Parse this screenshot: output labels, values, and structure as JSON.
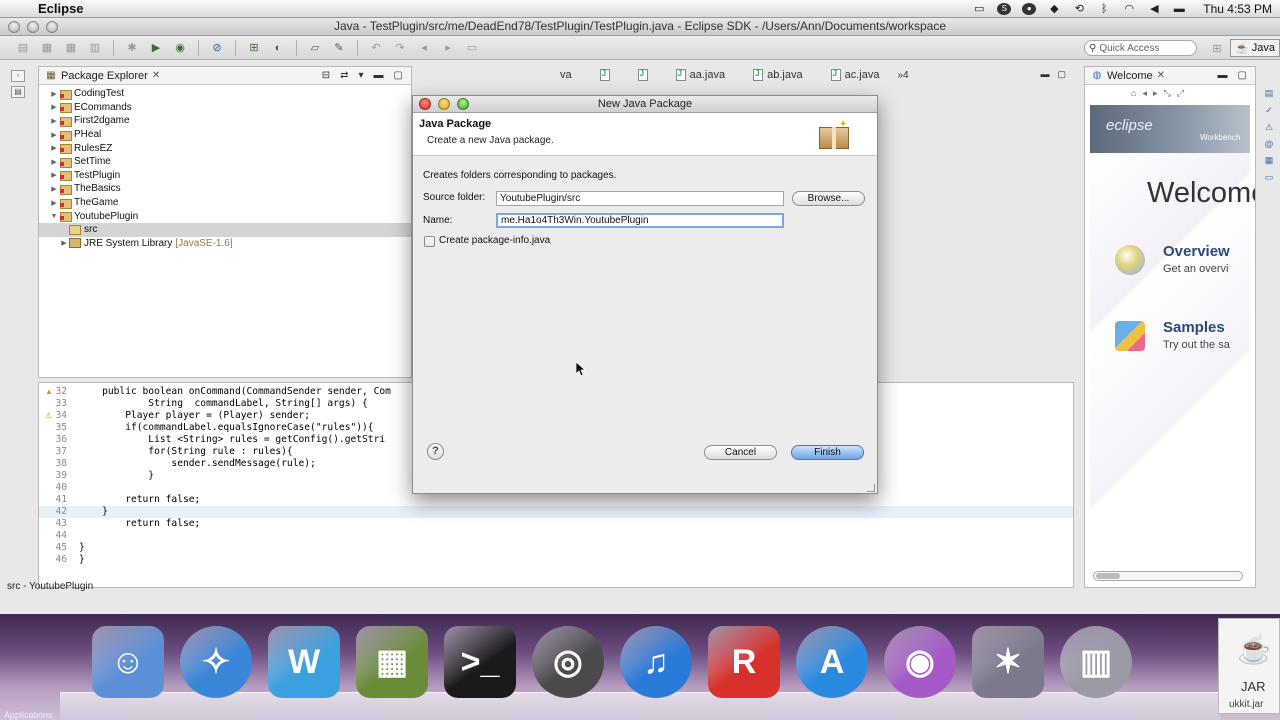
{
  "menubar": {
    "app_name": "Eclipse",
    "time": "Thu 4:53 PM"
  },
  "window": {
    "title": "Java - TestPlugin/src/me/DeadEnd78/TestPlugin/TestPlugin.java - Eclipse SDK - /Users/Ann/Documents/workspace"
  },
  "toolbar": {
    "quick_access_placeholder": "Quick Access",
    "perspective_label": "Java"
  },
  "package_explorer": {
    "title": "Package Explorer",
    "projects": [
      "CodingTest",
      "ECommands",
      "First2dgame",
      "PHeal",
      "RulesEZ",
      "SetTime",
      "TestPlugin",
      "TheBasics",
      "TheGame",
      "YoutubePlugin"
    ],
    "expanded_project": "YoutubePlugin",
    "children": [
      {
        "label": "src",
        "selected": true
      },
      {
        "label": "JRE System Library",
        "detail": "[JavaSE-1.6]"
      }
    ]
  },
  "editor": {
    "tabs": [
      "aa.java",
      "ab.java",
      "ac.java"
    ],
    "overflow_count": "»4",
    "lines": [
      {
        "n": "32",
        "code": "    public boolean onCommand(CommandSender sender, Com"
      },
      {
        "n": "33",
        "code": "            String  commandLabel, String[] args) {"
      },
      {
        "n": "34",
        "code": "        Player player = (Player) sender;"
      },
      {
        "n": "35",
        "code": "        if(commandLabel.equalsIgnoreCase(\"rules\")){"
      },
      {
        "n": "36",
        "code": "            List <String> rules = getConfig().getStri"
      },
      {
        "n": "37",
        "code": "            for(String rule : rules){"
      },
      {
        "n": "38",
        "code": "                sender.sendMessage(rule);"
      },
      {
        "n": "39",
        "code": "            }"
      },
      {
        "n": "40",
        "code": ""
      },
      {
        "n": "41",
        "code": "        return false;"
      },
      {
        "n": "42",
        "code": "    }"
      },
      {
        "n": "43",
        "code": "        return false;"
      },
      {
        "n": "44",
        "code": ""
      },
      {
        "n": "45",
        "code": "}"
      },
      {
        "n": "46",
        "code": "}"
      }
    ]
  },
  "welcome": {
    "tab_title": "Welcome",
    "banner_logo": "eclipse",
    "banner_sub": "Workbench",
    "heading": "Welcome",
    "items": [
      {
        "title": "Overview",
        "desc": "Get an overvi"
      },
      {
        "title": "Samples",
        "desc": "Try out the sa"
      }
    ]
  },
  "statusbar": {
    "text": "src - YoutubePlugin"
  },
  "dialog": {
    "title": "New Java Package",
    "heading": "Java Package",
    "subheading": "Create a new Java package.",
    "description": "Creates folders corresponding to packages.",
    "source_folder_label": "Source folder:",
    "source_folder_value": "YoutubePlugin/src",
    "browse_label": "Browse...",
    "name_label": "Name:",
    "name_value": "me.Ha1o4Th3Win.YoutubePlugin",
    "checkbox_label": "Create package-info.java",
    "help_label": "?",
    "cancel_label": "Cancel",
    "finish_label": "Finish"
  },
  "dock": {
    "items": [
      {
        "name": "finder",
        "color": "#5b8fd6"
      },
      {
        "name": "safari",
        "color": "#3a86d8"
      },
      {
        "name": "word",
        "color": "#3aa0e0"
      },
      {
        "name": "minecraft",
        "color": "#6a8c3a"
      },
      {
        "name": "terminal",
        "color": "#1a1a1a"
      },
      {
        "name": "quicktime",
        "color": "#4a4a4a"
      },
      {
        "name": "itunes",
        "color": "#2a7ad8"
      },
      {
        "name": "roblox",
        "color": "#d8302a"
      },
      {
        "name": "app-store",
        "color": "#2a8ae0"
      },
      {
        "name": "itunes-disc",
        "color": "#a55ac8"
      },
      {
        "name": "imovie",
        "color": "#7a7a8a"
      },
      {
        "name": "trash",
        "color": "#9a9aa5"
      }
    ],
    "jar_label": "JAR",
    "jar_sub": "ukkit.jar",
    "bottom_text": "Applications"
  },
  "colors": {
    "link_blue": "#2a4a7a",
    "default_button": "#6ea3e4",
    "keyword": "#7f0055"
  }
}
